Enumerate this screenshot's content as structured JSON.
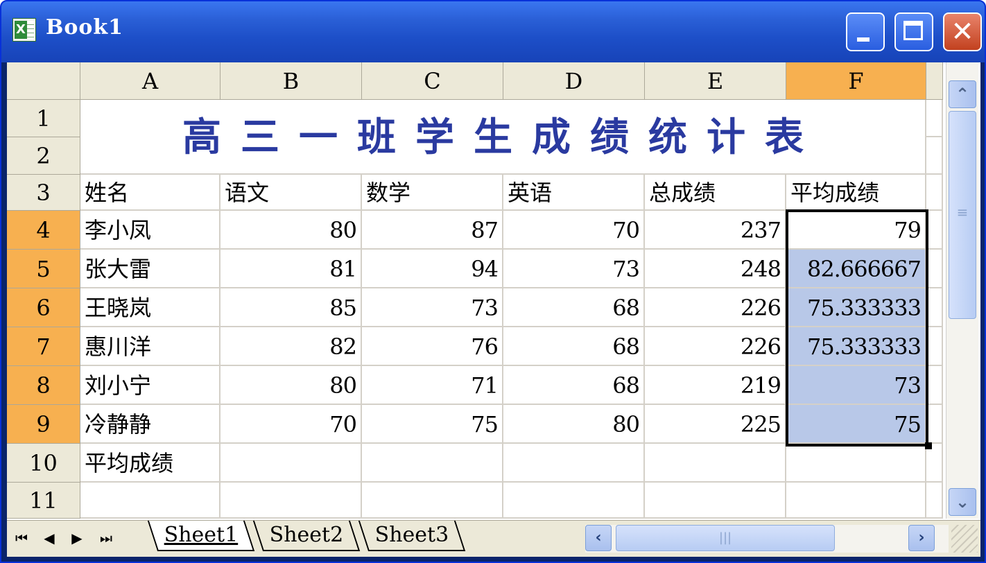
{
  "window": {
    "title": "Book1",
    "controls": {
      "minimize": "minimize",
      "maximize": "maximize",
      "close": "✕"
    }
  },
  "columns": [
    "A",
    "B",
    "C",
    "D",
    "E",
    "F"
  ],
  "selected_column": "F",
  "rows": [
    "1",
    "2",
    "3",
    "4",
    "5",
    "6",
    "7",
    "8",
    "9",
    "10",
    "11"
  ],
  "selected_rows": [
    "4",
    "5",
    "6",
    "7",
    "8",
    "9"
  ],
  "sheet": {
    "title": "高三一班学生成绩统计表",
    "headers": [
      "姓名",
      "语文",
      "数学",
      "英语",
      "总成绩",
      "平均成绩"
    ],
    "students": [
      {
        "name": "李小凤",
        "chinese": "80",
        "math": "87",
        "english": "70",
        "total": "237",
        "average": "79"
      },
      {
        "name": "张大雷",
        "chinese": "81",
        "math": "94",
        "english": "73",
        "total": "248",
        "average": "82.666667"
      },
      {
        "name": "王晓岚",
        "chinese": "85",
        "math": "73",
        "english": "68",
        "total": "226",
        "average": "75.333333"
      },
      {
        "name": "惠川洋",
        "chinese": "82",
        "math": "76",
        "english": "68",
        "total": "226",
        "average": "75.333333"
      },
      {
        "name": "刘小宁",
        "chinese": "80",
        "math": "71",
        "english": "68",
        "total": "219",
        "average": "73"
      },
      {
        "name": "冷静静",
        "chinese": "70",
        "math": "75",
        "english": "80",
        "total": "225",
        "average": "75"
      }
    ],
    "footer_label": "平均成绩"
  },
  "tabs": {
    "sheet1": "Sheet1",
    "sheet2": "Sheet2",
    "sheet3": "Sheet3",
    "active": "Sheet1"
  },
  "nav": {
    "first": "⏮",
    "prev": "◀",
    "next": "▶",
    "last": "⏭"
  },
  "colors": {
    "title_text": "#2a3aa0",
    "header_selected": "#f7b050",
    "selection_fill": "#b8c8e8"
  }
}
